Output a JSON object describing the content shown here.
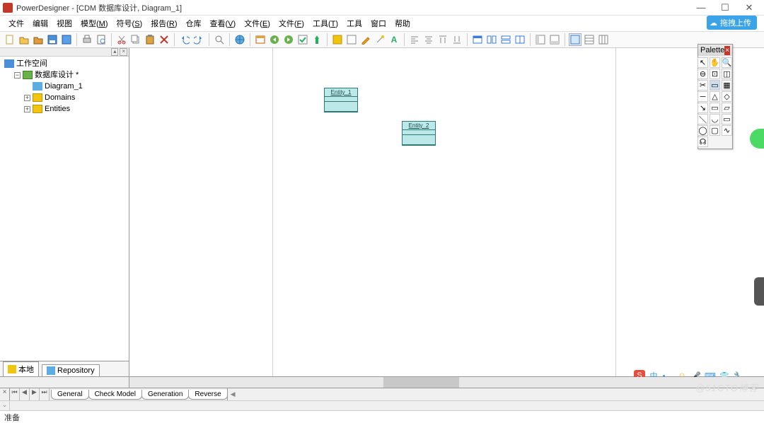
{
  "title": "PowerDesigner - [CDM 数据库设计, Diagram_1]",
  "upload_badge": "拖拽上传",
  "menus": [
    {
      "label": "文件",
      "key": ""
    },
    {
      "label": "编辑",
      "key": ""
    },
    {
      "label": "视图",
      "key": ""
    },
    {
      "label": "模型",
      "key": "M"
    },
    {
      "label": "符号",
      "key": "S"
    },
    {
      "label": "报告",
      "key": "R"
    },
    {
      "label": "仓库",
      "key": ""
    },
    {
      "label": "查看",
      "key": "V"
    },
    {
      "label": "文件",
      "key": "E"
    },
    {
      "label": "文件",
      "key": "F"
    },
    {
      "label": "工具",
      "key": "T"
    },
    {
      "label": "工具",
      "key": ""
    },
    {
      "label": "窗口",
      "key": ""
    },
    {
      "label": "帮助",
      "key": ""
    }
  ],
  "tree": {
    "root": "工作空间",
    "model": "数据库设计 *",
    "diagram": "Diagram_1",
    "domains": "Domains",
    "entities": "Entities"
  },
  "side_tabs": {
    "local": "本地",
    "repo": "Repository"
  },
  "entities": [
    {
      "name": "Entity_1"
    },
    {
      "name": "Entity_2"
    }
  ],
  "palette_title": "Palette",
  "bottom_tabs": [
    "General",
    "Check Model",
    "Generation",
    "Reverse"
  ],
  "status": "准备",
  "watermark": "@51CTO博客"
}
